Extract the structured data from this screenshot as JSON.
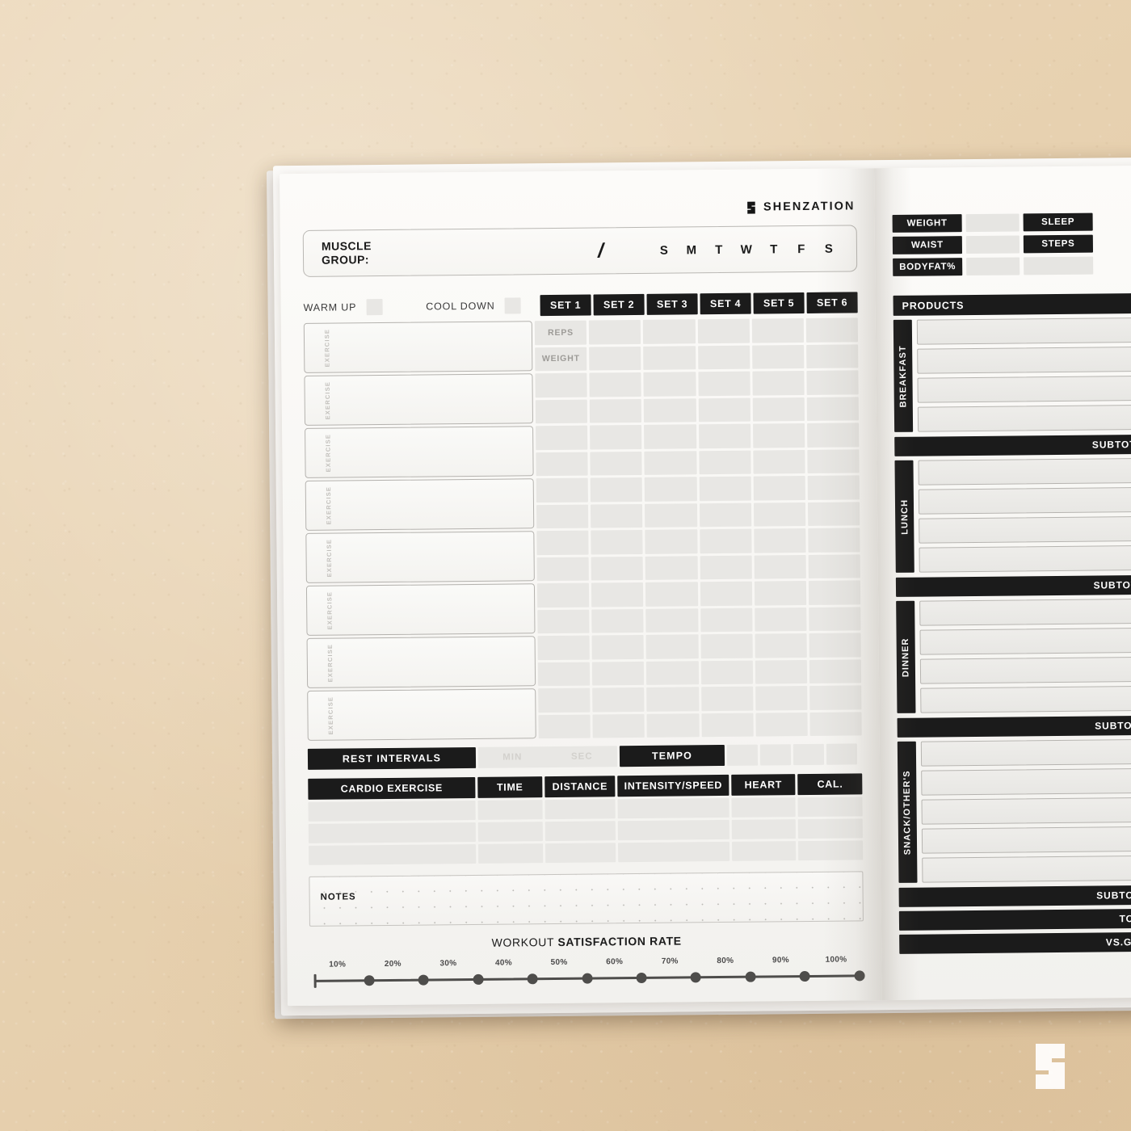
{
  "brand": {
    "name": "SHENZATION",
    "mark": "shenzation-s-logo"
  },
  "left_page": {
    "muscle_group": {
      "label": "MUSCLE\nGROUP:",
      "slash": "/",
      "days": [
        "S",
        "M",
        "T",
        "W",
        "T",
        "F",
        "S"
      ]
    },
    "warm_up_label": "WARM UP",
    "cool_down_label": "COOL DOWN",
    "set_headers": [
      "SET 1",
      "SET 2",
      "SET 3",
      "SET 4",
      "SET 5",
      "SET 6"
    ],
    "exercise_row_label": "EXERCISE",
    "exercise_rows": [
      1,
      2,
      3,
      4,
      5,
      6,
      7,
      8
    ],
    "reps_label": "REPS",
    "weight_label": "WEIGHT",
    "rest_intervals_label": "REST INTERVALS",
    "min_label": "MIN",
    "sec_label": "SEC",
    "tempo_label": "TEMPO",
    "tempo_boxes": [
      1,
      2,
      3,
      4
    ],
    "cardio_headers": [
      "CARDIO EXERCISE",
      "TIME",
      "DISTANCE",
      "INTENSITY/SPEED",
      "HEART",
      "CAL."
    ],
    "cardio_rows": [
      1,
      2,
      3
    ],
    "notes_label": "NOTES",
    "satisfaction": {
      "title_light": "WORKOUT ",
      "title_bold": "SATISFACTION RATE",
      "ticks": [
        "10%",
        "20%",
        "30%",
        "40%",
        "50%",
        "60%",
        "70%",
        "80%",
        "90%",
        "100%"
      ]
    }
  },
  "right_page": {
    "measurements": {
      "left_labels": [
        "WEIGHT",
        "WAIST",
        "BODYFAT%"
      ],
      "right_labels": [
        "SLEEP",
        "STEPS",
        ""
      ]
    },
    "products_header": "PRODUCTS",
    "meals": [
      {
        "name": "BREAKFAST",
        "lines": 4,
        "subtotal": "SUBTOTAL"
      },
      {
        "name": "LUNCH",
        "lines": 4,
        "subtotal": "SUBTOTAL"
      },
      {
        "name": "DINNER",
        "lines": 4,
        "subtotal": "SUBTOTAL"
      },
      {
        "name": "SNACK/OTHER'S",
        "lines": 5,
        "subtotal": "SUBTOTAL"
      }
    ],
    "total_label": "TOTAL",
    "vs_goal_label": "VS.GOAL"
  },
  "colors": {
    "background": "#e9d4b5",
    "paper": "#f8f7f4",
    "ink": "#1b1b1b",
    "cell": "#e8e7e4",
    "muted": "#9d9b97"
  }
}
